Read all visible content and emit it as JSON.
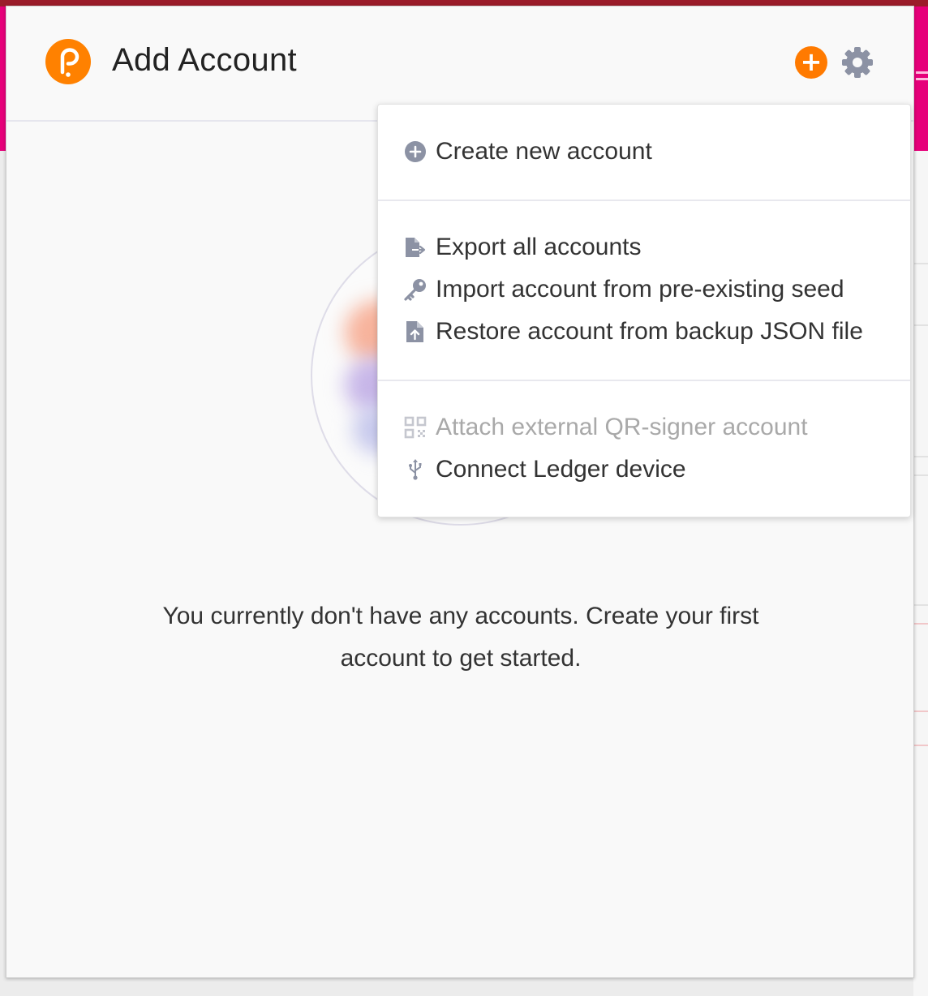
{
  "header": {
    "title": "Add Account",
    "add_button_symbol": "+",
    "accent_color": "#ff7a00"
  },
  "menu": {
    "items": [
      {
        "label": "Create new account",
        "icon": "plus-circle-icon",
        "enabled": true
      },
      {
        "label": "Export all accounts",
        "icon": "file-export-icon",
        "enabled": true
      },
      {
        "label": "Import account from pre-existing seed",
        "icon": "key-icon",
        "enabled": true
      },
      {
        "label": "Restore account from backup JSON file",
        "icon": "file-upload-icon",
        "enabled": true
      },
      {
        "label": "Attach external QR-signer account",
        "icon": "qrcode-icon",
        "enabled": false
      },
      {
        "label": "Connect Ledger device",
        "icon": "usb-icon",
        "enabled": true
      }
    ]
  },
  "empty_state": {
    "message": "You currently don't have any accounts. Create your first account to get started."
  }
}
